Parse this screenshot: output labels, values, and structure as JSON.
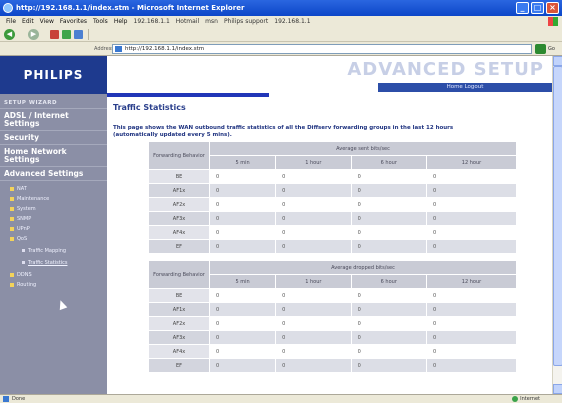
{
  "window": {
    "title": "http://192.168.1.1/index.stm - Microsoft Internet Explorer"
  },
  "menubar": {
    "items": [
      "File",
      "Edit",
      "View",
      "Favorites",
      "Tools",
      "Help"
    ],
    "links": [
      "192.168.1.1",
      "Hotmail",
      "msn",
      "Philips support",
      "192.168.1.1"
    ]
  },
  "addressbar": {
    "label": "Address",
    "url": "http://192.168.1.1/index.stm",
    "go": "Go"
  },
  "header": {
    "logo": "PHILIPS",
    "banner": "ADVANCED SETUP",
    "home_links": "Home  Logout"
  },
  "sidebar": {
    "title": "SETUP WIZARD",
    "items": [
      "ADSL / Internet Settings",
      "Security",
      "Home Network Settings",
      "Advanced Settings"
    ],
    "sub_items": [
      "NAT",
      "Maintenance",
      "System",
      "SNMP",
      "UPnP",
      "QoS"
    ],
    "qos_sub": [
      "Traffic Mapping",
      "Traffic Statistics"
    ],
    "more_items": [
      "DDNS",
      "Routing"
    ]
  },
  "main": {
    "title": "Traffic Statistics",
    "description": "This page shows the WAN outbound traffic statistics of all the Diffserv forwarding groups in the last 12 hours (automatically updated every 5 mins).",
    "sent_table": {
      "behavior_header": "Forwarding Behavior",
      "group_header": "Average sent bits/sec",
      "columns": [
        "5 min",
        "1 hour",
        "6 hour",
        "12 hour"
      ],
      "rows": [
        {
          "label": "BE",
          "values": [
            "0",
            "0",
            "0",
            "0"
          ]
        },
        {
          "label": "AF1x",
          "values": [
            "0",
            "0",
            "0",
            "0"
          ]
        },
        {
          "label": "AF2x",
          "values": [
            "0",
            "0",
            "0",
            "0"
          ]
        },
        {
          "label": "AF3x",
          "values": [
            "0",
            "0",
            "0",
            "0"
          ]
        },
        {
          "label": "AF4x",
          "values": [
            "0",
            "0",
            "0",
            "0"
          ]
        },
        {
          "label": "EF",
          "values": [
            "0",
            "0",
            "0",
            "0"
          ]
        }
      ]
    },
    "dropped_table": {
      "behavior_header": "Forwarding Behavior",
      "group_header": "Average dropped bits/sec",
      "columns": [
        "5 min",
        "1 hour",
        "6 hour",
        "12 hour"
      ],
      "rows": [
        {
          "label": "BE",
          "values": [
            "0",
            "0",
            "0",
            "0"
          ]
        },
        {
          "label": "AF1x",
          "values": [
            "0",
            "0",
            "0",
            "0"
          ]
        },
        {
          "label": "AF2x",
          "values": [
            "0",
            "0",
            "0",
            "0"
          ]
        },
        {
          "label": "AF3x",
          "values": [
            "0",
            "0",
            "0",
            "0"
          ]
        },
        {
          "label": "AF4x",
          "values": [
            "0",
            "0",
            "0",
            "0"
          ]
        },
        {
          "label": "EF",
          "values": [
            "0",
            "0",
            "0",
            "0"
          ]
        }
      ]
    }
  },
  "statusbar": {
    "left": "Done",
    "right": "Internet"
  }
}
